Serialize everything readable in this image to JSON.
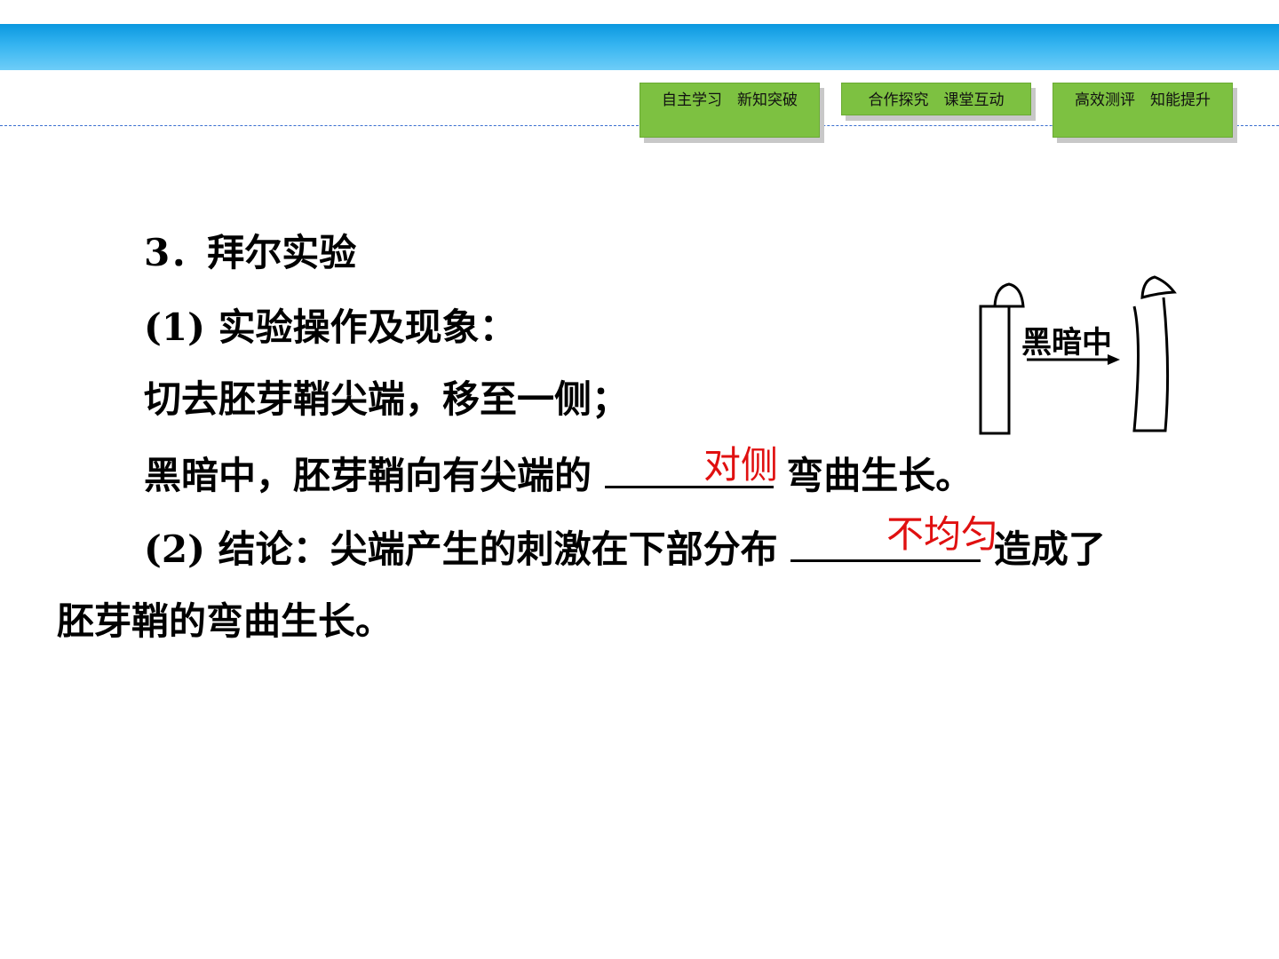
{
  "nav": {
    "btn1": "自主学习　新知突破",
    "btn2": "合作探究　课堂互动",
    "btn3": "高效测评　知能提升"
  },
  "content": {
    "heading": "3．拜尔实验",
    "sub1": "(1) 实验操作及现象：",
    "line_a": "切去胚芽鞘尖端，移至一侧；",
    "line_b_pre": "黑暗中，胚芽鞘向有尖端的 ",
    "line_b_post": " 弯曲生长。",
    "answer1": "对侧",
    "line_c_pre": "(2) 结论：尖端产生的刺激在下部分布 ",
    "line_c_post": " 造成了",
    "answer2": "不均匀",
    "line_d": "胚芽鞘的弯曲生长。"
  },
  "diagram": {
    "label": "黑暗中"
  },
  "colors": {
    "band": "#1aa3e8",
    "nav_green": "#7dc141",
    "answer_red": "#e01010",
    "dash_blue": "#3a6fd0"
  }
}
